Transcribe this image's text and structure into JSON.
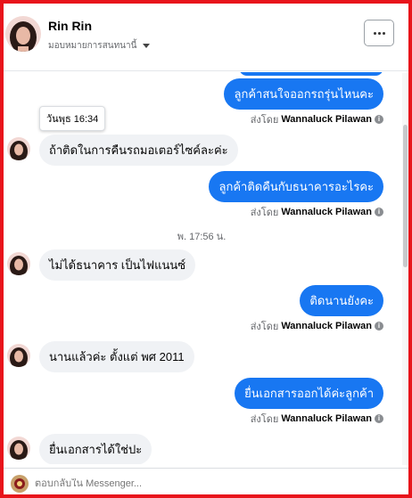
{
  "header": {
    "contact_name": "Rin Rin",
    "assign_label": "มอบหมายการสนทนานี้"
  },
  "tooltip": {
    "time": "วันพุธ 16:34"
  },
  "divider": {
    "time": "พ. 17:56 น."
  },
  "messages": [
    {
      "direction": "out",
      "text": "ลูกค้าสนใจออกรถรุ่นไหนคะ"
    },
    {
      "direction": "in",
      "text": "ถ้าติดในการคืนรถมอเตอร์ไซค์ละค่ะ"
    },
    {
      "direction": "out",
      "text": "ลูกค้าติดคืนกับธนาคารอะไรคะ"
    },
    {
      "direction": "in",
      "text": "ไม่ได้ธนาคาร เป็นไฟแนนซ์"
    },
    {
      "direction": "out",
      "text": "ติดนานยังคะ"
    },
    {
      "direction": "in",
      "text": "นานแล้วค่ะ ตั้งแต่ พศ 2011"
    },
    {
      "direction": "out",
      "text": "ยื่นเอกสารออกได้ค่ะลูกค้า"
    },
    {
      "direction": "in",
      "text": "ยื่นเอกสารได้ใช่ปะ"
    }
  ],
  "sent_by": {
    "prefix": "ส่งโดย",
    "agent": "Wannaluck Pilawan"
  },
  "composer": {
    "placeholder": "ตอบกลับใน Messenger..."
  },
  "colors": {
    "accent": "#1877f2",
    "frame": "#e8141b",
    "incoming_bubble": "#f0f2f5"
  }
}
